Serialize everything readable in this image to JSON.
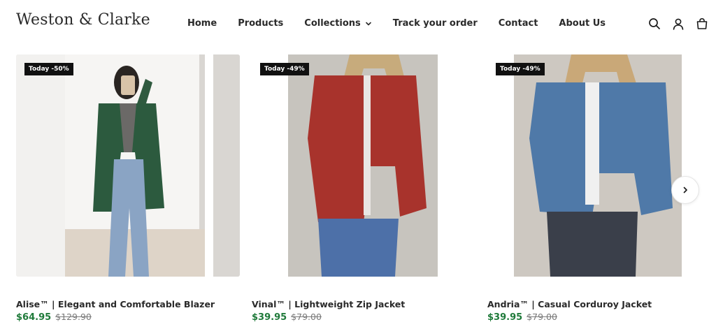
{
  "header": {
    "logo": "Weston & Clarke",
    "nav": [
      {
        "label": "Home"
      },
      {
        "label": "Products"
      },
      {
        "label": "Collections"
      },
      {
        "label": "Track your order"
      },
      {
        "label": "Contact"
      },
      {
        "label": "About Us"
      }
    ],
    "icons": [
      "search-icon",
      "account-icon",
      "cart-icon"
    ]
  },
  "products": [
    {
      "badge": "Today -50%",
      "title": "Alise™ | Elegant and Comfortable Blazer",
      "price": "$64.95",
      "old_price": "$129.90",
      "image": "woman-green-blazer-photo"
    },
    {
      "badge": "Today -49%",
      "title": "Vinal™ | Lightweight Zip Jacket",
      "price": "$39.95",
      "old_price": "$79.00",
      "image": "woman-red-zip-jacket-photo"
    },
    {
      "badge": "Today -49%",
      "title": "Andria™ | Casual Corduroy Jacket",
      "price": "$39.95",
      "old_price": "$79.00",
      "image": "woman-blue-corduroy-jacket-photo"
    }
  ],
  "carousel": {
    "next_icon": "chevron-right-icon"
  },
  "colors": {
    "sale_price": "#1f7a3a",
    "badge_bg": "#111111"
  }
}
